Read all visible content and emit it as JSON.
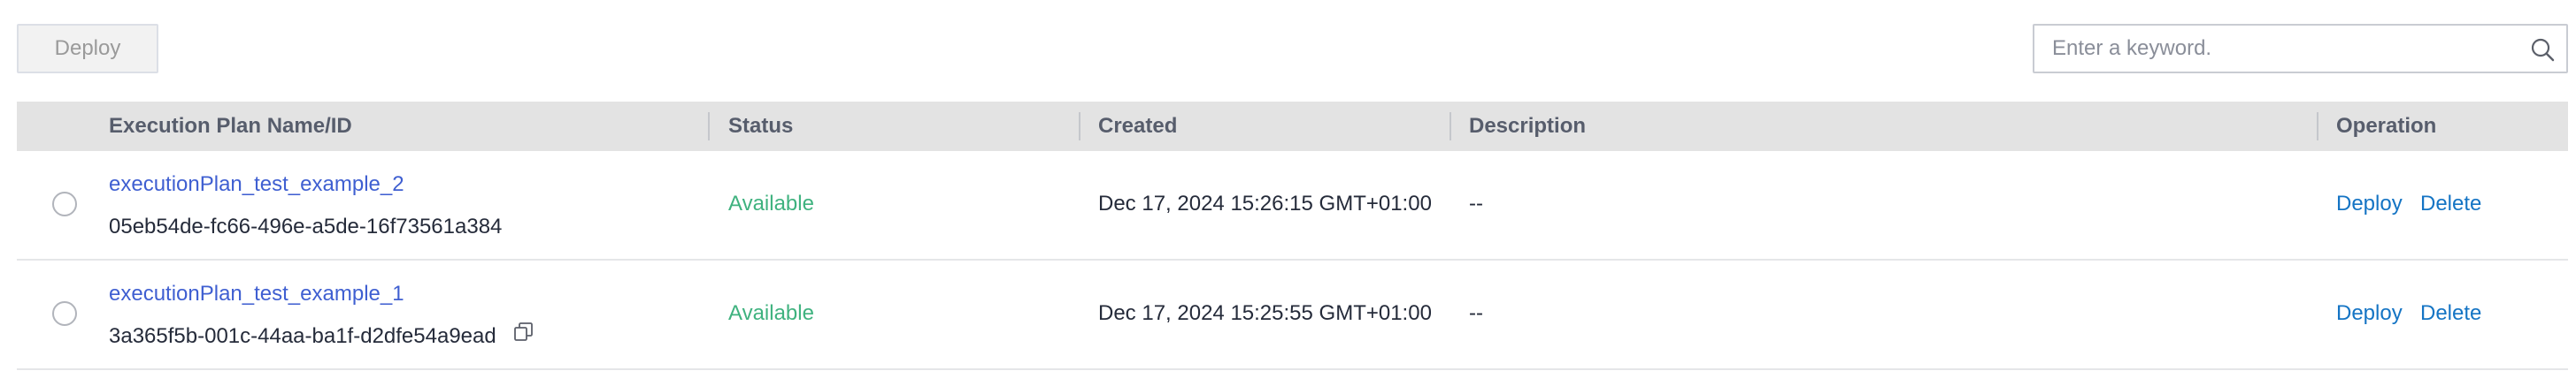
{
  "toolbar": {
    "deploy_label": "Deploy"
  },
  "search": {
    "placeholder": "Enter a keyword.",
    "icon": "search-icon"
  },
  "table": {
    "columns": {
      "name": "Execution Plan Name/ID",
      "status": "Status",
      "created": "Created",
      "description": "Description",
      "operation": "Operation"
    },
    "rows": [
      {
        "name": "executionPlan_test_example_2",
        "id": "05eb54de-fc66-496e-a5de-16f73561a384",
        "status": "Available",
        "created": "Dec 17, 2024 15:26:15 GMT+01:00",
        "description": "--",
        "op_deploy": "Deploy",
        "op_delete": "Delete",
        "show_copy_icon": false
      },
      {
        "name": "executionPlan_test_example_1",
        "id": "3a365f5b-001c-44aa-ba1f-d2dfe54a9ead",
        "status": "Available",
        "created": "Dec 17, 2024 15:25:55 GMT+01:00",
        "description": "--",
        "op_deploy": "Deploy",
        "op_delete": "Delete",
        "show_copy_icon": true
      }
    ]
  },
  "colors": {
    "link": "#3f5fd1",
    "status_available": "#3fb27f",
    "operation_link": "#1474c4",
    "header_bg": "#e3e3e3"
  }
}
